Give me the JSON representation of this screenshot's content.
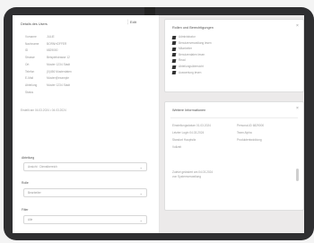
{
  "header": {
    "title": "Details des Users",
    "menu_icon": "dots-icon",
    "menu_label": "Edit"
  },
  "details": [
    {
      "label": "Vorname",
      "value": "JULIE"
    },
    {
      "label": "Nachname",
      "value": "BORNHOFFER"
    },
    {
      "label": "ID",
      "value": "6829000"
    },
    {
      "label": "Strasse",
      "value": "Beispielstrasse 12"
    },
    {
      "label": "Ort",
      "value": "Muster 1234 Stadt"
    },
    {
      "label": "Telefon",
      "value": "(0)456 Musterdaten"
    },
    {
      "label": "E-Mail",
      "value": "Muster@example"
    },
    {
      "label": "Abteilung",
      "value": "Muster 1234 Stadt"
    },
    {
      "label": "Status",
      "value": ""
    }
  ],
  "details_footer": "Erstellt am 04.03.2024 • 04.03.2024",
  "fields": [
    {
      "label": "Abteilung",
      "value": "Ansicht · Dienstbereich"
    },
    {
      "label": "Rolle",
      "value": "Bearbeiter"
    },
    {
      "label": "Filter",
      "value": "Alle"
    }
  ],
  "rights_card": {
    "title": "Rollen und Berechtigungen",
    "items": [
      "Administrator",
      "Benutzerverwaltung lesen",
      "Mitarbeiter",
      "Benutzerdaten lesen",
      "Read",
      "Abteilungsübersicht",
      "Auswertung lesen"
    ]
  },
  "extra_card": {
    "title": "Weitere Informationen",
    "rows": [
      {
        "left": "Einstellungsdatum 01.03.2024",
        "right": "Personal-ID 6829000"
      },
      {
        "left": "Letzter Login 04.03.2024",
        "right": "Team Alpha"
      },
      {
        "left": "Standort Hauptsitz",
        "right": "Produktentwicklung"
      },
      {
        "left": "Vollzeit",
        "right": ""
      }
    ],
    "meta": [
      "Zuletzt geändert am 04.03.2024",
      "von Systemverwaltung"
    ]
  }
}
